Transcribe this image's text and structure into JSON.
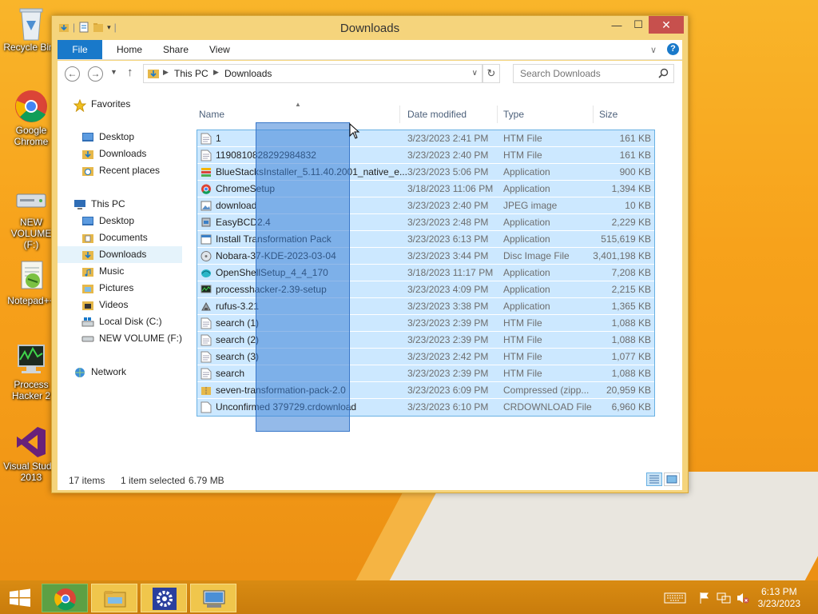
{
  "desktop": {
    "icons": [
      {
        "label": "Recycle Bin",
        "icon": "recycle-bin-icon"
      },
      {
        "label": "Google Chrome",
        "icon": "chrome-icon"
      },
      {
        "label": "NEW VOLUME (F:)",
        "icon": "drive-icon"
      },
      {
        "label": "Notepad++",
        "icon": "notepad-icon"
      },
      {
        "label": "Process Hacker 2",
        "icon": "process-hacker-icon"
      },
      {
        "label": "Visual Studio 2013",
        "icon": "visual-studio-icon"
      }
    ]
  },
  "window": {
    "title": "Downloads",
    "ribbon": {
      "file": "File",
      "home": "Home",
      "share": "Share",
      "view": "View"
    },
    "address": {
      "crumb1": "This PC",
      "crumb2": "Downloads"
    },
    "search": {
      "placeholder": "Search Downloads"
    },
    "navpane": {
      "favorites": "Favorites",
      "favorites_items": [
        "Desktop",
        "Downloads",
        "Recent places"
      ],
      "thispc": "This PC",
      "thispc_items": [
        "Desktop",
        "Documents",
        "Downloads",
        "Music",
        "Pictures",
        "Videos",
        "Local Disk (C:)",
        "NEW VOLUME (F:)"
      ],
      "network": "Network",
      "selected": "Downloads"
    },
    "columns": {
      "name": "Name",
      "date": "Date modified",
      "type": "Type",
      "size": "Size"
    },
    "files": [
      {
        "name": "1",
        "date": "3/23/2023 2:41 PM",
        "type": "HTM File",
        "size": "161 KB",
        "icon": "html-file-icon"
      },
      {
        "name": "1190810828292984832",
        "date": "3/23/2023 2:40 PM",
        "type": "HTM File",
        "size": "161 KB",
        "icon": "html-file-icon"
      },
      {
        "name": "BlueStacksInstaller_5.11.40.2001_native_e...",
        "date": "3/23/2023 5:06 PM",
        "type": "Application",
        "size": "900 KB",
        "icon": "bluestacks-icon"
      },
      {
        "name": "ChromeSetup",
        "date": "3/18/2023 11:06 PM",
        "type": "Application",
        "size": "1,394 KB",
        "icon": "chrome-setup-icon"
      },
      {
        "name": "download",
        "date": "3/23/2023 2:40 PM",
        "type": "JPEG image",
        "size": "10 KB",
        "icon": "image-file-icon"
      },
      {
        "name": "EasyBCD2.4",
        "date": "3/23/2023 2:48 PM",
        "type": "Application",
        "size": "2,229 KB",
        "icon": "installer-icon"
      },
      {
        "name": "Install Transformation Pack",
        "date": "3/23/2023 6:13 PM",
        "type": "Application",
        "size": "515,619 KB",
        "icon": "application-icon"
      },
      {
        "name": "Nobara-37-KDE-2023-03-04",
        "date": "3/23/2023 3:44 PM",
        "type": "Disc Image File",
        "size": "3,401,198 KB",
        "icon": "disc-image-icon"
      },
      {
        "name": "OpenShellSetup_4_4_170",
        "date": "3/18/2023 11:17 PM",
        "type": "Application",
        "size": "7,208 KB",
        "icon": "openshell-icon"
      },
      {
        "name": "processhacker-2.39-setup",
        "date": "3/23/2023 4:09 PM",
        "type": "Application",
        "size": "2,215 KB",
        "icon": "processhacker-setup-icon"
      },
      {
        "name": "rufus-3.21",
        "date": "3/23/2023 3:38 PM",
        "type": "Application",
        "size": "1,365 KB",
        "icon": "rufus-icon"
      },
      {
        "name": "search (1)",
        "date": "3/23/2023 2:39 PM",
        "type": "HTM File",
        "size": "1,088 KB",
        "icon": "html-file-icon"
      },
      {
        "name": "search (2)",
        "date": "3/23/2023 2:39 PM",
        "type": "HTM File",
        "size": "1,088 KB",
        "icon": "html-file-icon"
      },
      {
        "name": "search (3)",
        "date": "3/23/2023 2:42 PM",
        "type": "HTM File",
        "size": "1,077 KB",
        "icon": "html-file-icon"
      },
      {
        "name": "search",
        "date": "3/23/2023 2:39 PM",
        "type": "HTM File",
        "size": "1,088 KB",
        "icon": "html-file-icon"
      },
      {
        "name": "seven-transformation-pack-2.0",
        "date": "3/23/2023 6:09 PM",
        "type": "Compressed (zipp...",
        "size": "20,959 KB",
        "icon": "zip-folder-icon"
      },
      {
        "name": "Unconfirmed 379729.crdownload",
        "date": "3/23/2023 6:10 PM",
        "type": "CRDOWNLOAD File",
        "size": "6,960 KB",
        "icon": "blank-file-icon"
      }
    ],
    "status": {
      "count": "17 items",
      "selected": "1 item selected",
      "size": "6.79 MB"
    }
  },
  "taskbar": {
    "apps": [
      "start-icon",
      "chrome-icon",
      "file-explorer-icon",
      "settings-icon",
      "remote-desktop-icon"
    ],
    "time": "6:13 PM",
    "date": "3/23/2023"
  },
  "colors": {
    "accent": "#1979ca",
    "selection": "#cce8ff",
    "selection_border": "#69b1e3",
    "titlebar": "#f5d47c",
    "close": "#c7504d",
    "taskbar": "#d98b12"
  }
}
